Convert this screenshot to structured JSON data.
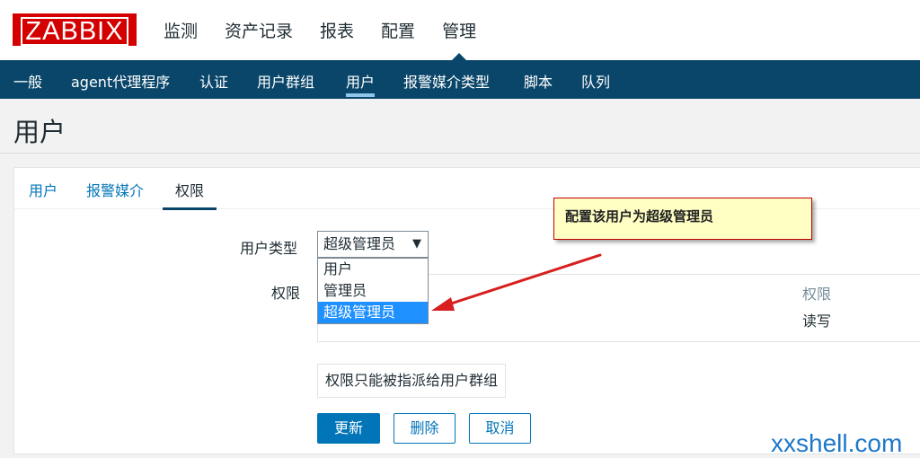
{
  "logo": "ZABBIX",
  "main_menu": [
    "监测",
    "资产记录",
    "报表",
    "配置",
    "管理"
  ],
  "sub_nav": [
    "一般",
    "agent代理程序",
    "认证",
    "用户群组",
    "用户",
    "报警媒介类型",
    "脚本",
    "队列"
  ],
  "page_title": "用户",
  "tabs": [
    "用户",
    "报警媒介",
    "权限"
  ],
  "form": {
    "user_type_label": "用户类型",
    "user_type_value": "超级管理员",
    "user_type_options": [
      "用户",
      "管理员",
      "超级管理员"
    ],
    "permissions_label": "权限",
    "perm_column_header": "权限",
    "perm_value": "读写",
    "note": "权限只能被指派给用户群组"
  },
  "buttons": {
    "update": "更新",
    "delete": "删除",
    "cancel": "取消"
  },
  "annotation": "配置该用户为超级管理员",
  "watermark": "xxshell.com",
  "colors": {
    "logo_red": "#d40000",
    "nav_blue": "#0a466a",
    "accent_blue": "#0275b8",
    "selected_option": "#1e90ff",
    "callout_bg": "#ffffc4",
    "arrow_red": "#d81e1e"
  }
}
